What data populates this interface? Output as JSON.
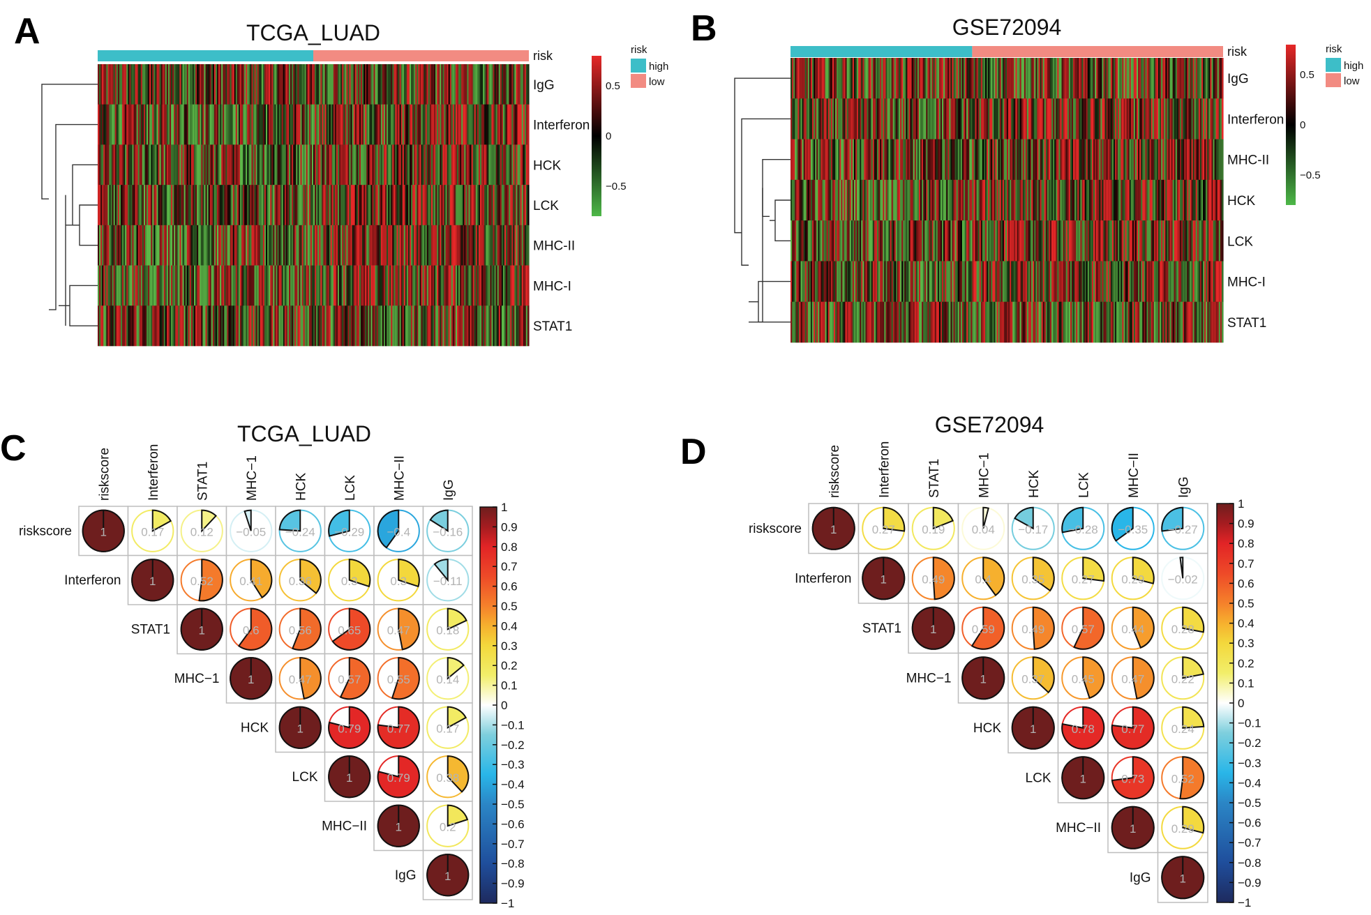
{
  "panel_labels": [
    "A",
    "B",
    "C",
    "D"
  ],
  "chart_data": [
    {
      "type": "heatmap",
      "panel": "A",
      "title": "TCGA_LUAD",
      "rows": [
        "IgG",
        "Interferon",
        "HCK",
        "LCK",
        "MHC-II",
        "MHC-I",
        "STAT1"
      ],
      "annotation": {
        "name": "risk",
        "groups": [
          {
            "label": "high",
            "fraction": 0.5,
            "color": "#3DBEC8"
          },
          {
            "label": "low",
            "fraction": 0.5,
            "color": "#F28B82"
          }
        ]
      },
      "colorbar": {
        "ticks": [
          0.5,
          0,
          -0.5
        ],
        "tick_labels": [
          "0.5",
          "0",
          "−0.5"
        ],
        "low_color": "#4DB848",
        "mid_color": "#000000",
        "high_color": "#E62828",
        "range": [
          -0.8,
          0.8
        ]
      },
      "legend": {
        "title": "risk",
        "items": [
          {
            "label": "high",
            "color": "#3DBEC8"
          },
          {
            "label": "low",
            "color": "#F28B82"
          }
        ]
      },
      "dendrogram": "row-clustered",
      "n_samples": "many (individual columns)"
    },
    {
      "type": "heatmap",
      "panel": "B",
      "title": "GSE72094",
      "rows": [
        "IgG",
        "Interferon",
        "MHC-II",
        "HCK",
        "LCK",
        "MHC-I",
        "STAT1"
      ],
      "annotation": {
        "name": "risk",
        "groups": [
          {
            "label": "high",
            "fraction": 0.42,
            "color": "#3DBEC8"
          },
          {
            "label": "low",
            "fraction": 0.58,
            "color": "#F28B82"
          }
        ]
      },
      "colorbar": {
        "ticks": [
          0.5,
          0,
          -0.5
        ],
        "tick_labels": [
          "0.5",
          "0",
          "−0.5"
        ],
        "low_color": "#4DB848",
        "mid_color": "#000000",
        "high_color": "#E62828",
        "range": [
          -0.8,
          0.8
        ]
      },
      "legend": {
        "title": "risk",
        "items": [
          {
            "label": "high",
            "color": "#3DBEC8"
          },
          {
            "label": "low",
            "color": "#F28B82"
          }
        ]
      },
      "dendrogram": "row-clustered",
      "n_samples": "many (individual columns)"
    },
    {
      "type": "heatmap",
      "subtype": "correlation-pie-matrix (upper triangle)",
      "panel": "C",
      "title": "TCGA_LUAD",
      "variables": [
        "riskscore",
        "Interferon",
        "STAT1",
        "MHC−1",
        "HCK",
        "LCK",
        "MHC−II",
        "IgG"
      ],
      "matrix": [
        [
          1,
          0.17,
          0.12,
          -0.05,
          -0.24,
          -0.29,
          -0.4,
          -0.16
        ],
        [
          null,
          1,
          0.52,
          0.41,
          0.36,
          0.3,
          0.3,
          -0.11
        ],
        [
          null,
          null,
          1,
          0.6,
          0.56,
          0.65,
          0.47,
          0.18
        ],
        [
          null,
          null,
          null,
          1,
          0.47,
          0.57,
          0.55,
          0.14
        ],
        [
          null,
          null,
          null,
          null,
          1,
          0.79,
          0.77,
          0.17
        ],
        [
          null,
          null,
          null,
          null,
          null,
          1,
          0.79,
          0.38
        ],
        [
          null,
          null,
          null,
          null,
          null,
          null,
          1,
          0.2
        ],
        [
          null,
          null,
          null,
          null,
          null,
          null,
          null,
          1
        ]
      ],
      "colorbar": {
        "range": [
          -1,
          1
        ],
        "ticks": [
          1,
          0.9,
          0.8,
          0.7,
          0.6,
          0.5,
          0.4,
          0.3,
          0.2,
          0.1,
          0,
          -0.1,
          -0.2,
          -0.3,
          -0.4,
          -0.5,
          -0.6,
          -0.7,
          -0.8,
          -0.9,
          -1
        ]
      }
    },
    {
      "type": "heatmap",
      "subtype": "correlation-pie-matrix (upper triangle)",
      "panel": "D",
      "title": "GSE72094",
      "variables": [
        "riskscore",
        "Interferon",
        "STAT1",
        "MHC−1",
        "HCK",
        "LCK",
        "MHC−II",
        "IgG"
      ],
      "matrix": [
        [
          1,
          0.27,
          0.19,
          0.04,
          -0.17,
          -0.28,
          -0.35,
          -0.27
        ],
        [
          null,
          1,
          0.49,
          0.4,
          0.35,
          0.27,
          0.29,
          -0.02
        ],
        [
          null,
          null,
          1,
          0.59,
          0.49,
          0.57,
          0.44,
          0.28
        ],
        [
          null,
          null,
          null,
          1,
          0.37,
          0.45,
          0.47,
          0.22
        ],
        [
          null,
          null,
          null,
          null,
          1,
          0.78,
          0.77,
          0.24
        ],
        [
          null,
          null,
          null,
          null,
          null,
          1,
          0.73,
          0.52
        ],
        [
          null,
          null,
          null,
          null,
          null,
          null,
          1,
          0.29
        ],
        [
          null,
          null,
          null,
          null,
          null,
          null,
          null,
          1
        ]
      ],
      "colorbar": {
        "range": [
          -1,
          1
        ],
        "ticks": [
          1,
          0.9,
          0.8,
          0.7,
          0.6,
          0.5,
          0.4,
          0.3,
          0.2,
          0.1,
          0,
          -0.1,
          -0.2,
          -0.3,
          -0.4,
          -0.5,
          -0.6,
          -0.7,
          -0.8,
          -0.9,
          -1
        ]
      }
    }
  ]
}
